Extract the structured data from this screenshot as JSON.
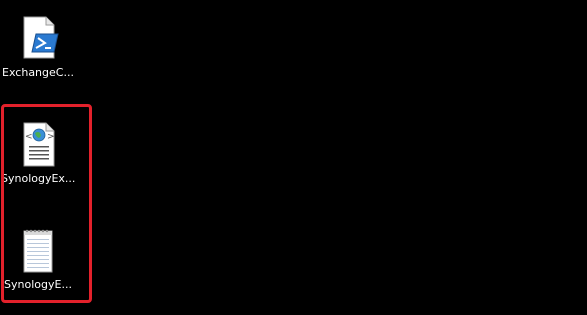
{
  "desktop": {
    "background_color": "#000000",
    "icons": [
      {
        "label": "ExchangeC...",
        "icon": "powershell-script-icon"
      },
      {
        "label": "SynologyEx...",
        "icon": "web-xml-file-icon"
      },
      {
        "label": "SynologyE...",
        "icon": "text-file-icon"
      }
    ]
  },
  "annotation": {
    "highlight_color": "#e3212b"
  }
}
